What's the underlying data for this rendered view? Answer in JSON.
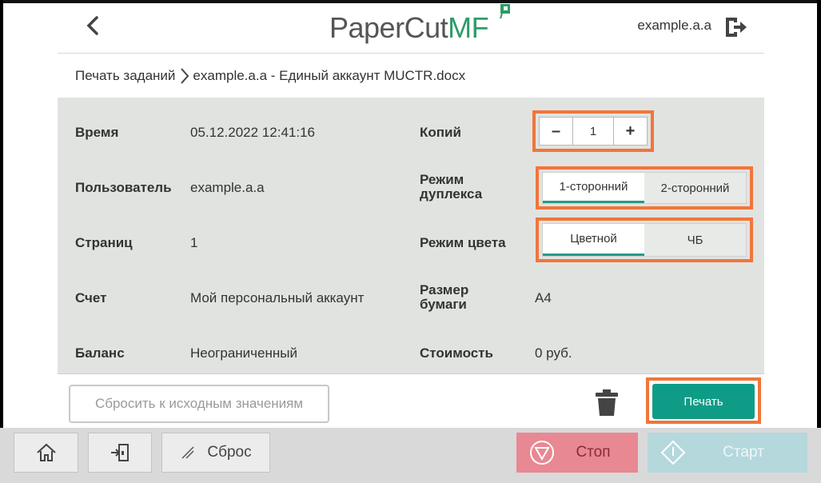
{
  "header": {
    "logo_main": "PaperCut",
    "logo_accent": "MF",
    "username": "example.a.a"
  },
  "breadcrumb": {
    "parent": "Печать заданий",
    "current": "example.a.a - Единый аккаунт MUCTR.docx"
  },
  "details": {
    "time_label": "Время",
    "time_value": "05.12.2022 12:41:16",
    "user_label": "Пользователь",
    "user_value": "example.a.a",
    "pages_label": "Страниц",
    "pages_value": "1",
    "account_label": "Счет",
    "account_value": "Мой персональный аккаунт",
    "balance_label": "Баланс",
    "balance_value": "Неограниченный"
  },
  "options": {
    "copies_label": "Копий",
    "copies_value": "1",
    "minus": "–",
    "plus": "+",
    "duplex_label_1": "Режим",
    "duplex_label_2": "дуплекса",
    "duplex_options": [
      "1-сторонний",
      "2-сторонний"
    ],
    "color_label": "Режим цвета",
    "color_options": [
      "Цветной",
      "ЧБ"
    ],
    "paper_label_1": "Размер",
    "paper_label_2": "бумаги",
    "paper_value": "A4",
    "cost_label": "Стоимость",
    "cost_value": "0 руб."
  },
  "actions": {
    "reset_label": "Сбросить к исходным значениям",
    "print_label": "Печать"
  },
  "panel": {
    "reset_label": "Сброс",
    "stop_label": "Стоп",
    "start_label": "Старт"
  },
  "colors": {
    "accent": "#0f9c86",
    "highlight": "#f0763b",
    "brand_green": "#2e9b6a"
  }
}
